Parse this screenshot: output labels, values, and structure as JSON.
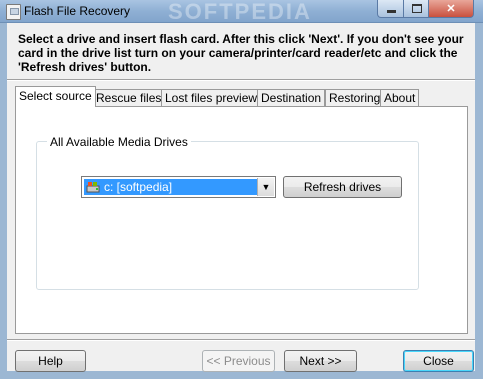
{
  "window": {
    "title": "Flash File Recovery",
    "watermark": "SOFTPEDIA",
    "controls": [
      "minimize",
      "maximize",
      "close"
    ]
  },
  "instructions": "Select a drive and insert flash card. After this click 'Next'. If you don't see your card in the drive list turn on your camera/printer/card reader/etc and click the 'Refresh drives' button.",
  "tabs": [
    {
      "label": "Select source",
      "active": true
    },
    {
      "label": "Rescue files",
      "active": false
    },
    {
      "label": "Lost files preview",
      "active": false
    },
    {
      "label": "Destination",
      "active": false
    },
    {
      "label": "Restoring",
      "active": false
    },
    {
      "label": "About",
      "active": false
    }
  ],
  "panel": {
    "group_label": "All Available Media Drives",
    "drive_select": {
      "value": "c: [softpedia]",
      "icon": "drive-icon"
    },
    "refresh_label": "Refresh drives"
  },
  "footer": {
    "help_label": "Help",
    "previous_label": "<< Previous",
    "next_label": "Next >>",
    "close_label": "Close"
  },
  "colors": {
    "selection": "#3399ff",
    "titlebar": "#8fb0d4",
    "dialog_bg": "#f0f0f0"
  }
}
